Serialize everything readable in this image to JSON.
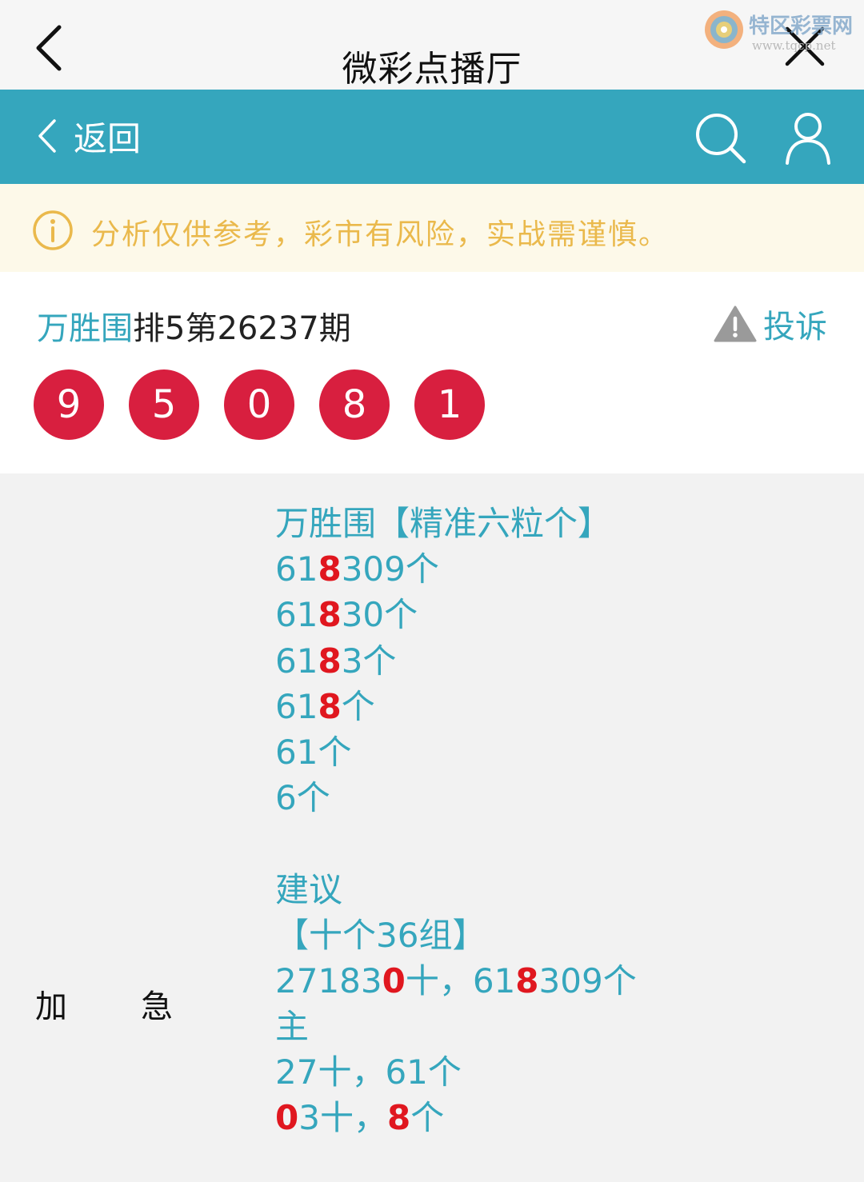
{
  "topbar": {
    "title": "微彩点播厅"
  },
  "watermark": {
    "name": "特区彩票网",
    "url": "www.tqcp.net"
  },
  "navbar": {
    "back_label": "返回"
  },
  "notice": {
    "text": "分析仅供参考，彩市有风险，实战需谨慎。"
  },
  "issue": {
    "name": "万胜围",
    "rest": "排5第26237期",
    "report_label": "投诉"
  },
  "balls": [
    "9",
    "5",
    "0",
    "8",
    "1"
  ],
  "side_labels": {
    "left": "加",
    "right": "急"
  },
  "colors": {
    "accent": "#35a6bd",
    "ball": "#d81f3f",
    "highlight": "#e0171f",
    "notice_text": "#eab94c"
  },
  "content": {
    "lines": [
      [
        {
          "t": "万胜围【精准六粒个】"
        }
      ],
      [
        {
          "t": "61"
        },
        {
          "t": "8",
          "hl": true
        },
        {
          "t": "309个"
        }
      ],
      [
        {
          "t": "61"
        },
        {
          "t": "8",
          "hl": true
        },
        {
          "t": "30个"
        }
      ],
      [
        {
          "t": "61"
        },
        {
          "t": "8",
          "hl": true
        },
        {
          "t": "3个"
        }
      ],
      [
        {
          "t": "61"
        },
        {
          "t": "8",
          "hl": true
        },
        {
          "t": "个"
        }
      ],
      [
        {
          "t": "61个"
        }
      ],
      [
        {
          "t": "6个"
        }
      ],
      [],
      [
        {
          "t": "建议"
        }
      ],
      [
        {
          "t": "【十个36组】"
        }
      ],
      [
        {
          "t": "27183"
        },
        {
          "t": "0",
          "hl": true
        },
        {
          "t": "十，61"
        },
        {
          "t": "8",
          "hl": true
        },
        {
          "t": "309个"
        }
      ],
      [
        {
          "t": "主"
        }
      ],
      [
        {
          "t": "27十，61个"
        }
      ],
      [
        {
          "t": "0",
          "hl": true
        },
        {
          "t": "3十，"
        },
        {
          "t": "8",
          "hl": true
        },
        {
          "t": "个"
        }
      ]
    ]
  }
}
